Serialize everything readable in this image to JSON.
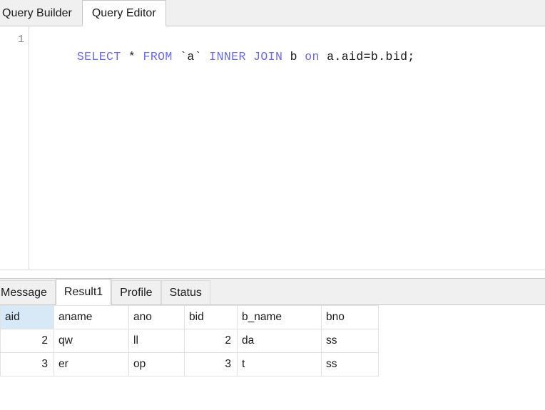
{
  "top_tabs": [
    {
      "label": "Query Builder",
      "active": false
    },
    {
      "label": "Query Editor",
      "active": true
    }
  ],
  "editor": {
    "line_number": "1",
    "sql_tokens": [
      {
        "text": "SELECT",
        "type": "keyword"
      },
      {
        "text": " * ",
        "type": "plain"
      },
      {
        "text": "FROM",
        "type": "keyword"
      },
      {
        "text": " `a` ",
        "type": "plain"
      },
      {
        "text": "INNER JOIN",
        "type": "keyword"
      },
      {
        "text": " b ",
        "type": "plain"
      },
      {
        "text": "on",
        "type": "keyword"
      },
      {
        "text": " a.aid=b.bid;",
        "type": "plain"
      }
    ],
    "sql_full": "SELECT * FROM `a` INNER JOIN b on a.aid=b.bid;",
    "keyword_color": "#6b6bdd",
    "text_color": "#1a1a1a"
  },
  "bottom_tabs": [
    {
      "label": "Message",
      "active": false
    },
    {
      "label": "Result1",
      "active": true
    },
    {
      "label": "Profile",
      "active": false
    },
    {
      "label": "Status",
      "active": false
    }
  ],
  "result_grid": {
    "selected_header": "aid",
    "selection_color": "#d7e8f7",
    "columns": [
      {
        "name": "aid",
        "align": "right"
      },
      {
        "name": "aname",
        "align": "left"
      },
      {
        "name": "ano",
        "align": "left"
      },
      {
        "name": "bid",
        "align": "right"
      },
      {
        "name": "b_name",
        "align": "left"
      },
      {
        "name": "bno",
        "align": "left"
      }
    ],
    "rows": [
      {
        "aid": "2",
        "aname": "qw",
        "ano": "ll",
        "bid": "2",
        "b_name": "da",
        "bno": "ss"
      },
      {
        "aid": "3",
        "aname": "er",
        "ano": "op",
        "bid": "3",
        "b_name": "t",
        "bno": "ss"
      }
    ]
  }
}
